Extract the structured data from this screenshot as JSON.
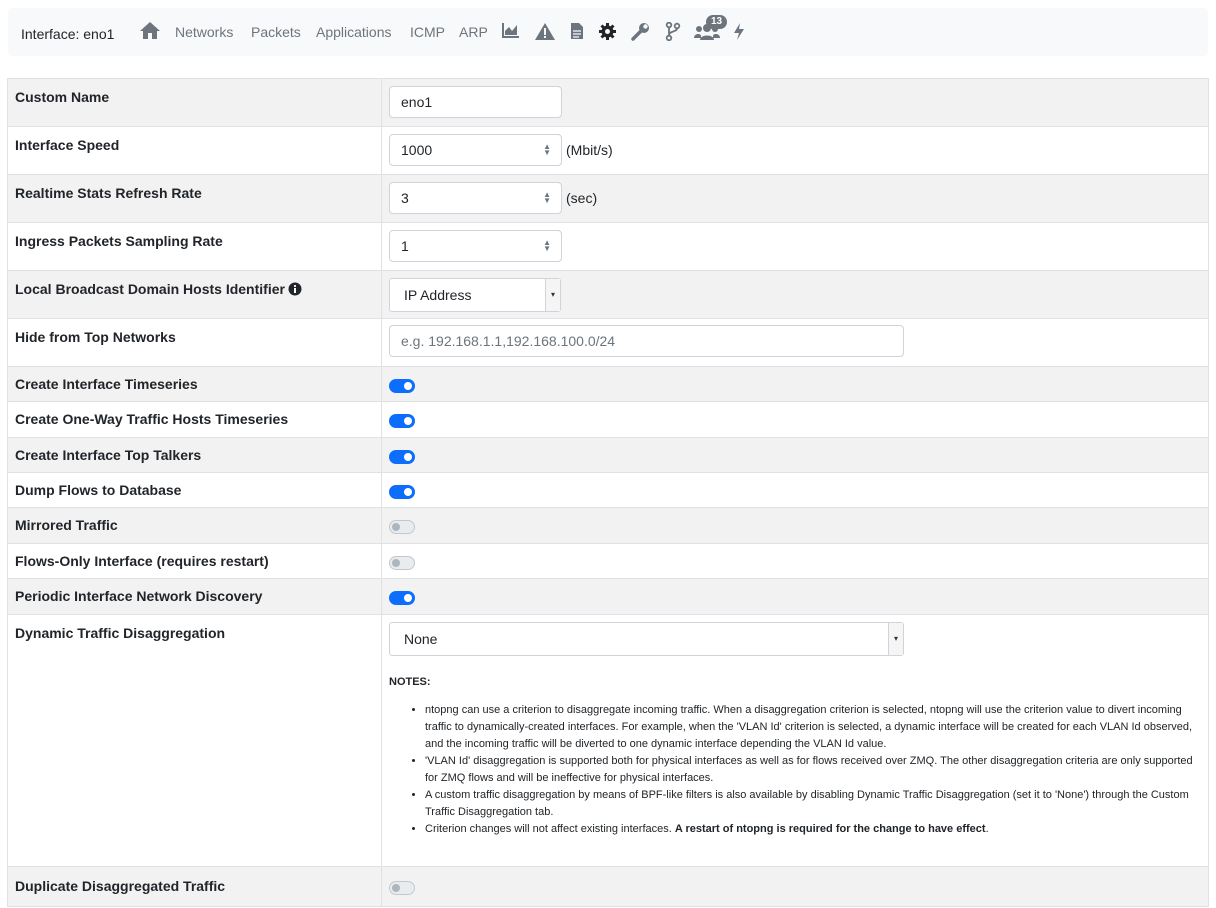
{
  "nav": {
    "title": "Interface: eno1",
    "links": [
      "Networks",
      "Packets",
      "Applications",
      "ICMP",
      "ARP"
    ],
    "badge_count": "13",
    "icons": [
      "home-icon",
      "chart-area-icon",
      "warning-icon",
      "file-icon",
      "gear-icon",
      "wrench-icon",
      "code-branch-icon",
      "users-icon",
      "bolt-icon"
    ]
  },
  "rows": {
    "custom_name": {
      "label": "Custom Name",
      "value": "eno1"
    },
    "interface_speed": {
      "label": "Interface Speed",
      "value": "1000",
      "unit": "(Mbit/s)"
    },
    "refresh_rate": {
      "label": "Realtime Stats Refresh Rate",
      "value": "3",
      "unit": "(sec)"
    },
    "sampling_rate": {
      "label": "Ingress Packets Sampling Rate",
      "value": "1"
    },
    "broadcast_id": {
      "label": "Local Broadcast Domain Hosts Identifier",
      "value": "IP Address"
    },
    "hide_networks": {
      "label": "Hide from Top Networks",
      "placeholder": "e.g. 192.168.1.1,192.168.100.0/24"
    },
    "toggles": [
      {
        "label": "Create Interface Timeseries",
        "on": true
      },
      {
        "label": "Create One-Way Traffic Hosts Timeseries",
        "on": true
      },
      {
        "label": "Create Interface Top Talkers",
        "on": true
      },
      {
        "label": "Dump Flows to Database",
        "on": true
      },
      {
        "label": "Mirrored Traffic",
        "on": false
      },
      {
        "label": "Flows-Only Interface (requires restart)",
        "on": false
      },
      {
        "label": "Periodic Interface Network Discovery",
        "on": true
      }
    ],
    "disaggregation": {
      "label": "Dynamic Traffic Disaggregation",
      "value": "None",
      "notes_title": "NOTES:",
      "notes": [
        "ntopng can use a criterion to disaggregate incoming traffic. When a disaggregation criterion is selected, ntopng will use the criterion value to divert incoming traffic to dynamically-created interfaces. For example, when the 'VLAN Id' criterion is selected, a dynamic interface will be created for each VLAN Id observed, and the incoming traffic will be diverted to one dynamic interface depending the VLAN Id value.",
        "'VLAN Id' disaggregation is supported both for physical interfaces as well as for flows received over ZMQ. The other disaggregation criteria are only supported for ZMQ flows and will be ineffective for physical interfaces.",
        "A custom traffic disaggregation by means of BPF-like filters is also available by disabling Dynamic Traffic Disaggregation (set it to 'None') through the Custom Traffic Disaggregation tab."
      ],
      "last_note": "Criterion changes will not affect existing interfaces. ",
      "last_note_bold": "A restart of ntopng is required for the change to have effect",
      "last_note_end": "."
    },
    "duplicate": {
      "label": "Duplicate Disaggregated Traffic",
      "on": false
    }
  }
}
